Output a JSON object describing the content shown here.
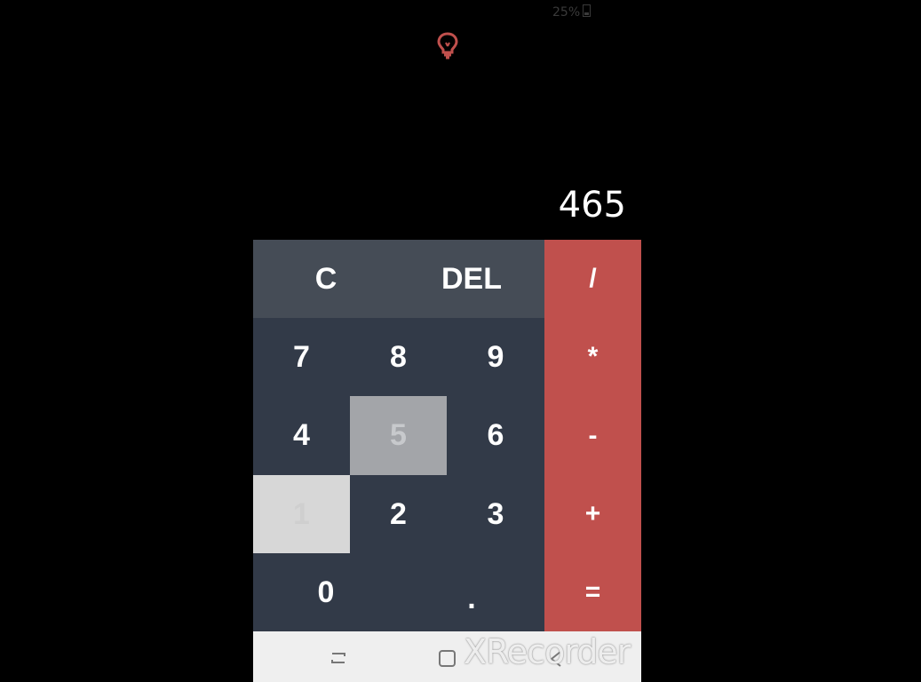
{
  "status_bar": {
    "battery_text": "25%"
  },
  "theme_toggle": {
    "icon": "lightbulb-icon",
    "color": "#c0504d"
  },
  "display": {
    "value": "465"
  },
  "keys": {
    "clear": "C",
    "delete": "DEL",
    "divide": "/",
    "multiply": "*",
    "subtract": "-",
    "add": "+",
    "equals": "=",
    "seven": "7",
    "eight": "8",
    "nine": "9",
    "four": "4",
    "five": "5",
    "six": "6",
    "one": "1",
    "two": "2",
    "three": "3",
    "zero": "0",
    "decimal": "."
  },
  "colors": {
    "operator_bg": "#c0504d",
    "number_bg": "#323a48",
    "top_row_bg": "#454c56",
    "pressed_key_bg": "#a3a5a9"
  },
  "nav_bar": {
    "recent_icon": "recent-apps-icon",
    "home_icon": "home-icon",
    "back_icon": "back-icon"
  },
  "watermark": {
    "text": "XRecorder"
  }
}
